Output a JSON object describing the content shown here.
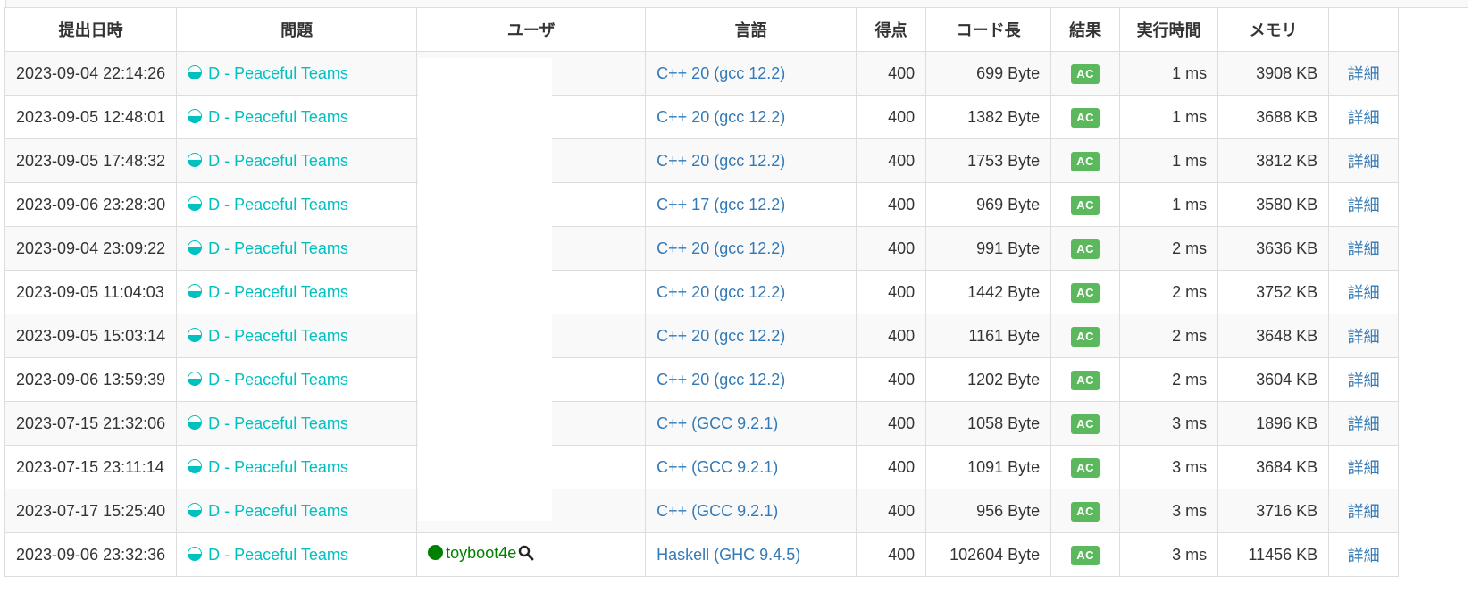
{
  "table": {
    "headers": {
      "submitted": "提出日時",
      "task": "問題",
      "user": "ユーザ",
      "language": "言語",
      "score": "得点",
      "code_length": "コード長",
      "result": "結果",
      "exec_time": "実行時間",
      "memory": "メモリ",
      "detail": ""
    },
    "rows": [
      {
        "time": "2023-09-04 22:14:26",
        "task": "D - Peaceful Teams",
        "user": "",
        "lang": "C++ 20 (gcc 12.2)",
        "score": "400",
        "len": "699 Byte",
        "result": "AC",
        "exec": "1 ms",
        "mem": "3908 KB",
        "detail": "詳細"
      },
      {
        "time": "2023-09-05 12:48:01",
        "task": "D - Peaceful Teams",
        "user": "",
        "lang": "C++ 20 (gcc 12.2)",
        "score": "400",
        "len": "1382 Byte",
        "result": "AC",
        "exec": "1 ms",
        "mem": "3688 KB",
        "detail": "詳細"
      },
      {
        "time": "2023-09-05 17:48:32",
        "task": "D - Peaceful Teams",
        "user": "",
        "lang": "C++ 20 (gcc 12.2)",
        "score": "400",
        "len": "1753 Byte",
        "result": "AC",
        "exec": "1 ms",
        "mem": "3812 KB",
        "detail": "詳細"
      },
      {
        "time": "2023-09-06 23:28:30",
        "task": "D - Peaceful Teams",
        "user": "",
        "lang": "C++ 17 (gcc 12.2)",
        "score": "400",
        "len": "969 Byte",
        "result": "AC",
        "exec": "1 ms",
        "mem": "3580 KB",
        "detail": "詳細"
      },
      {
        "time": "2023-09-04 23:09:22",
        "task": "D - Peaceful Teams",
        "user": "",
        "lang": "C++ 20 (gcc 12.2)",
        "score": "400",
        "len": "991 Byte",
        "result": "AC",
        "exec": "2 ms",
        "mem": "3636 KB",
        "detail": "詳細"
      },
      {
        "time": "2023-09-05 11:04:03",
        "task": "D - Peaceful Teams",
        "user": "",
        "lang": "C++ 20 (gcc 12.2)",
        "score": "400",
        "len": "1442 Byte",
        "result": "AC",
        "exec": "2 ms",
        "mem": "3752 KB",
        "detail": "詳細"
      },
      {
        "time": "2023-09-05 15:03:14",
        "task": "D - Peaceful Teams",
        "user": "",
        "lang": "C++ 20 (gcc 12.2)",
        "score": "400",
        "len": "1161 Byte",
        "result": "AC",
        "exec": "2 ms",
        "mem": "3648 KB",
        "detail": "詳細"
      },
      {
        "time": "2023-09-06 13:59:39",
        "task": "D - Peaceful Teams",
        "user": "",
        "lang": "C++ 20 (gcc 12.2)",
        "score": "400",
        "len": "1202 Byte",
        "result": "AC",
        "exec": "2 ms",
        "mem": "3604 KB",
        "detail": "詳細"
      },
      {
        "time": "2023-07-15 21:32:06",
        "task": "D - Peaceful Teams",
        "user": "",
        "lang": "C++ (GCC 9.2.1)",
        "score": "400",
        "len": "1058 Byte",
        "result": "AC",
        "exec": "3 ms",
        "mem": "1896 KB",
        "detail": "詳細"
      },
      {
        "time": "2023-07-15 23:11:14",
        "task": "D - Peaceful Teams",
        "user": "",
        "lang": "C++ (GCC 9.2.1)",
        "score": "400",
        "len": "1091 Byte",
        "result": "AC",
        "exec": "3 ms",
        "mem": "3684 KB",
        "detail": "詳細"
      },
      {
        "time": "2023-07-17 15:25:40",
        "task": "D - Peaceful Teams",
        "user": "",
        "lang": "C++ (GCC 9.2.1)",
        "score": "400",
        "len": "956 Byte",
        "result": "AC",
        "exec": "3 ms",
        "mem": "3716 KB",
        "detail": "詳細"
      },
      {
        "time": "2023-09-06 23:32:36",
        "task": "D - Peaceful Teams",
        "user": "toyboot4e",
        "lang": "Haskell (GHC 9.4.5)",
        "score": "400",
        "len": "102604 Byte",
        "result": "AC",
        "exec": "3 ms",
        "mem": "11456 KB",
        "detail": "詳細"
      }
    ]
  },
  "colors": {
    "link": "#337ab7",
    "task": "#00c0c0",
    "ac": "#5cb85c",
    "user_green": "#008000"
  },
  "icons": {
    "task_status": "half-filled-circle-icon",
    "user_rank": "green-rank-dot-icon",
    "user_search": "magnifier-icon"
  }
}
